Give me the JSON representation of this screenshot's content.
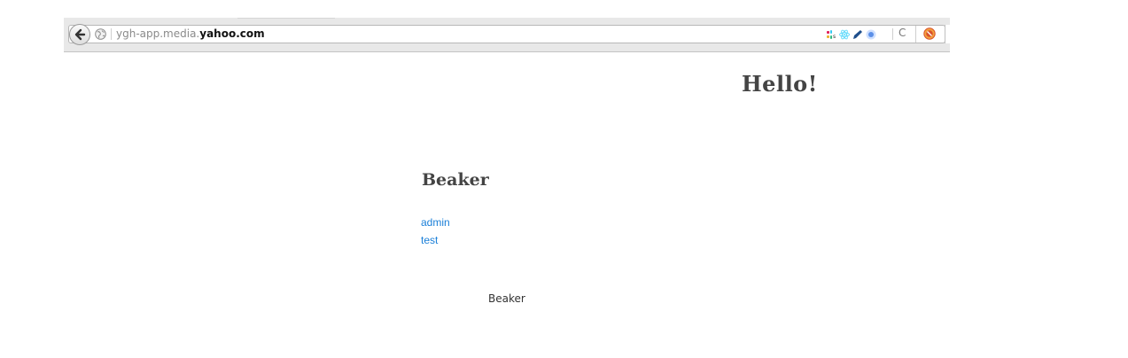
{
  "browser": {
    "url_prefix": "ygh-app.media.",
    "url_domain": "yahoo.com",
    "extension_icons": [
      "slack-icon",
      "react-devtools-icon",
      "pencil-extension-icon",
      "circle-extension-icon"
    ],
    "reload_glyph": "C"
  },
  "page": {
    "hello_heading": "Hello!",
    "app_heading": "Beaker",
    "links": [
      {
        "label": "admin"
      },
      {
        "label": "test"
      }
    ],
    "footer": "Beaker"
  },
  "colors": {
    "link": "#1a7fd8",
    "heading": "#444444"
  }
}
